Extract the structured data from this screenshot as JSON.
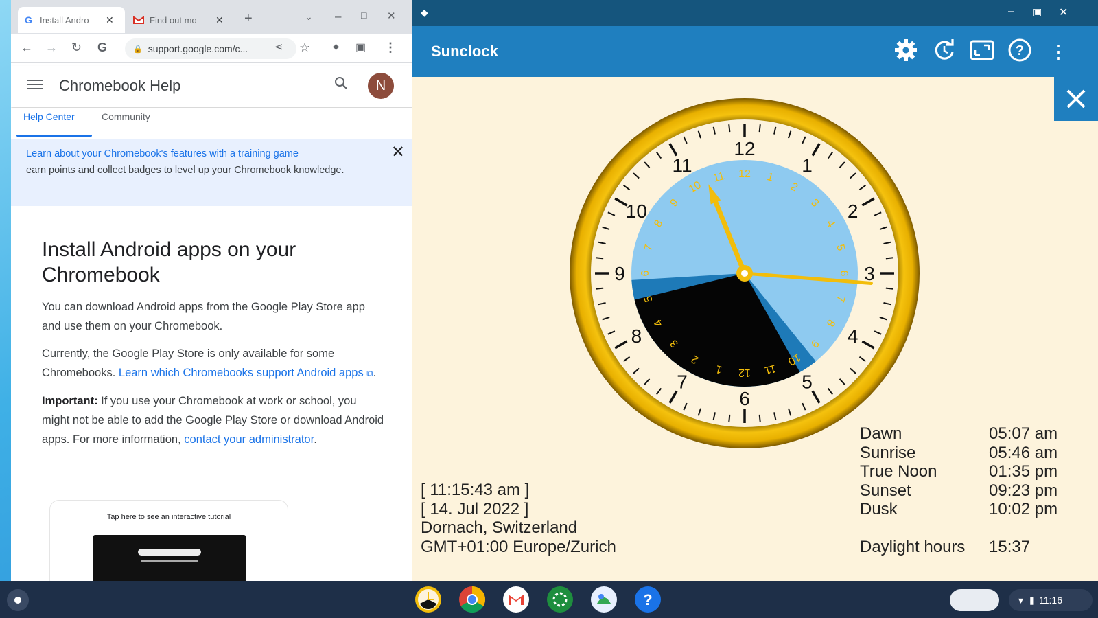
{
  "chrome": {
    "tabs": [
      {
        "title": "Install Andro",
        "favicon": "google-g-icon"
      },
      {
        "title": "Find out mo",
        "favicon": "gmail-icon"
      }
    ],
    "new_tab_label": "+",
    "url": "support.google.com/c...",
    "help_title": "Chromebook Help",
    "avatar_initial": "N",
    "help_tabs": [
      "Help Center",
      "Community"
    ],
    "banner": {
      "link": "Learn about your Chromebook's features with a training game",
      "text": "earn points and collect badges to level up your Chromebook knowledge."
    },
    "article": {
      "title": "Install Android apps on your Chromebook",
      "p1": "You can download Android apps from the Google Play Store app and use them on your Chromebook.",
      "p2_text": "Currently, the Google Play Store is only available for some Chromebooks.",
      "p2_link": "Learn which Chromebooks support Android apps",
      "p3_bold": "Important:",
      "p3_text": "If you use your Chromebook at work or school, you might not be able to add the Google Play Store or download Android apps. For more information,",
      "p3_link": "contact your administrator",
      "tutorial_caption": "Tap here to see an interactive tutorial"
    }
  },
  "sunclock": {
    "title": "Sunclock",
    "clock": {
      "time_hours": 11.2625,
      "outer_numbers": [
        "12",
        "1",
        "2",
        "3",
        "4",
        "5",
        "6",
        "7",
        "8",
        "9",
        "10",
        "11"
      ],
      "inner_numbers": [
        "12",
        "1",
        "2",
        "3",
        "4",
        "5",
        "6",
        "7",
        "8",
        "9",
        "10",
        "11",
        "12",
        "1",
        "2",
        "3",
        "4",
        "5",
        "6",
        "7",
        "8",
        "9",
        "10",
        "11"
      ],
      "night_start_hour24": 22.05,
      "night_end_hour24": 5.1,
      "twilight_evening_start_hour24": 21.4,
      "twilight_morning_end_hour24": 5.77,
      "colors": {
        "day": "#8ecaf0",
        "twilight": "#1e7ab8",
        "night": "#050505",
        "rim": "#f2bd0b",
        "hands": "#f2bd0b"
      }
    },
    "current_time": "[ 11:15:43 am ]",
    "current_date": "[ 14. Jul 2022 ]",
    "location": "Dornach, Switzerland",
    "timezone": "GMT+01:00 Europe/Zurich",
    "sun_events": [
      {
        "label": "Dawn",
        "time": "05:07 am"
      },
      {
        "label": "Sunrise",
        "time": "05:46 am"
      },
      {
        "label": "True Noon",
        "time": "01:35 pm"
      },
      {
        "label": "Sunset",
        "time": "09:23 pm"
      },
      {
        "label": "Dusk",
        "time": "10:02 pm"
      }
    ],
    "daylight_label": "Daylight hours",
    "daylight_value": "15:37"
  },
  "shelf": {
    "apps": [
      "sunclock-app-icon",
      "chrome-icon",
      "gmail-icon",
      "settings-app-icon",
      "photos-app-icon",
      "help-app-icon"
    ],
    "clock": "11:16"
  }
}
